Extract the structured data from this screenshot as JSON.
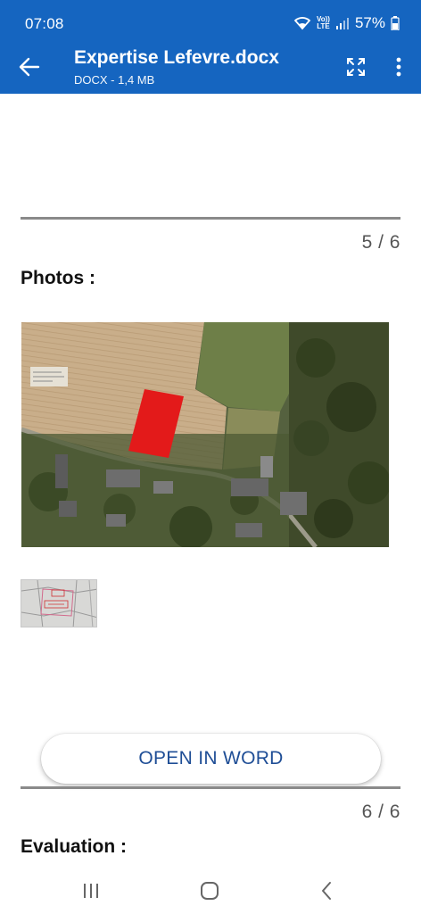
{
  "status_bar": {
    "time": "07:08",
    "volte_top": "Vo))",
    "volte_bottom": "LTE",
    "battery_percent": "57%"
  },
  "app_bar": {
    "title": "Expertise Lefevre.docx",
    "subtitle": "DOCX - 1,4 MB",
    "icons": [
      "back-arrow-icon",
      "fullscreen-icon",
      "more-vert-icon"
    ]
  },
  "document": {
    "page5": {
      "counter": "5 / 6",
      "heading": "Photos :"
    },
    "page6": {
      "counter": "6 / 6",
      "heading": "Evaluation :"
    },
    "images": [
      "aerial-photo",
      "cadastral-plan-thumbnail"
    ]
  },
  "open_in_word": {
    "label": "OPEN IN WORD"
  },
  "colors": {
    "app_bar": "#1565c0",
    "button_text": "#1f4e96",
    "highlight_parcel": "#e31a1a"
  },
  "nav_bar": {
    "icons": [
      "recent-apps-icon",
      "home-icon",
      "back-icon"
    ]
  }
}
